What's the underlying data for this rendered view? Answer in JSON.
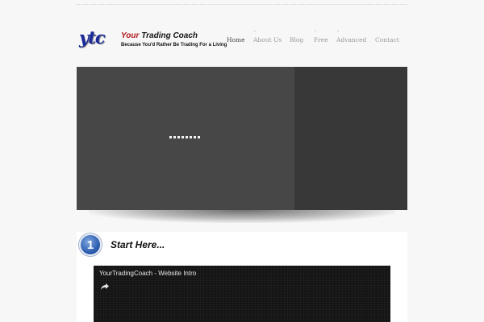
{
  "brand": {
    "logo_text": "ytc",
    "title_your": "Your",
    "title_rest": " Trading Coach",
    "tagline": "Because You'd Rather Be Trading For a Living"
  },
  "nav": {
    "items": [
      {
        "label": "Home",
        "active": true,
        "has_dropdown": false
      },
      {
        "label": "About Us",
        "active": false,
        "has_dropdown": true
      },
      {
        "label": "Blog",
        "active": false,
        "has_dropdown": false
      },
      {
        "label": "Free",
        "active": false,
        "has_dropdown": true
      },
      {
        "label": "Advanced",
        "active": false,
        "has_dropdown": true
      },
      {
        "label": "Contact",
        "active": false,
        "has_dropdown": false
      }
    ],
    "dropdown_marker": "-"
  },
  "slider": {
    "loading_dots": 8
  },
  "section": {
    "step_number": "1",
    "heading": "Start Here..."
  },
  "video": {
    "title": "YourTradingCoach - Website Intro",
    "share_icon": "share-arrow-icon"
  },
  "colors": {
    "logo_blue": "#1a2a9c",
    "accent_red": "#b3171c",
    "slider_bg": "#474747",
    "slider_side": "#383838",
    "badge_blue": "#2f5fb0"
  }
}
